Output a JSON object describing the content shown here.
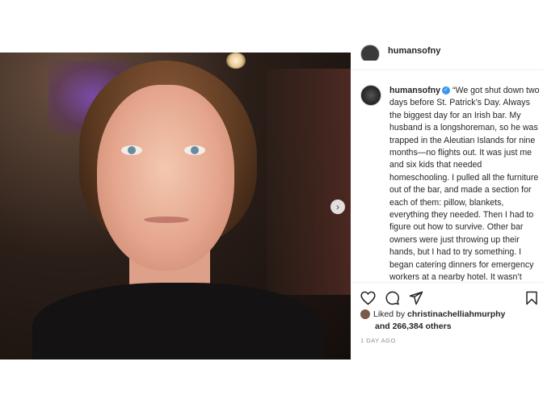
{
  "post": {
    "top_username": "humansofny",
    "username": "humansofny",
    "caption": "“We got shut down two days before St. Patrick’s Day. Always the biggest day for an Irish bar. My husband is a longshoreman, so he was trapped in the Aleutian Islands for nine months—no flights out. It was just me and six kids that needed homeschooling. I pulled all the furniture out of the bar, and made a section for each of them: pillow, blankets, everything they needed. Then I had to figure out how to survive. Other bar owners were just throwing up their hands, but I had to try something. I began catering dinners for emergency workers at a nearby hotel. It wasn’t much money, but it was something to do. Each night I’d cook dinner for thirty people. The kids would help when they",
    "liked_by_prefix": "Liked by",
    "liked_by_user": "christinachelliahmurphy",
    "and_label": "and",
    "likes_count": "266,384 others",
    "date": "1 DAY AGO"
  },
  "icons": {
    "like": "heart-icon",
    "comment": "comment-icon",
    "share": "share-icon",
    "save": "bookmark-icon",
    "next": "chevron-right-icon",
    "verified": "verified-badge-icon"
  },
  "colors": {
    "verified": "#3897f0",
    "text": "#262626",
    "muted": "#8e8e8e"
  }
}
